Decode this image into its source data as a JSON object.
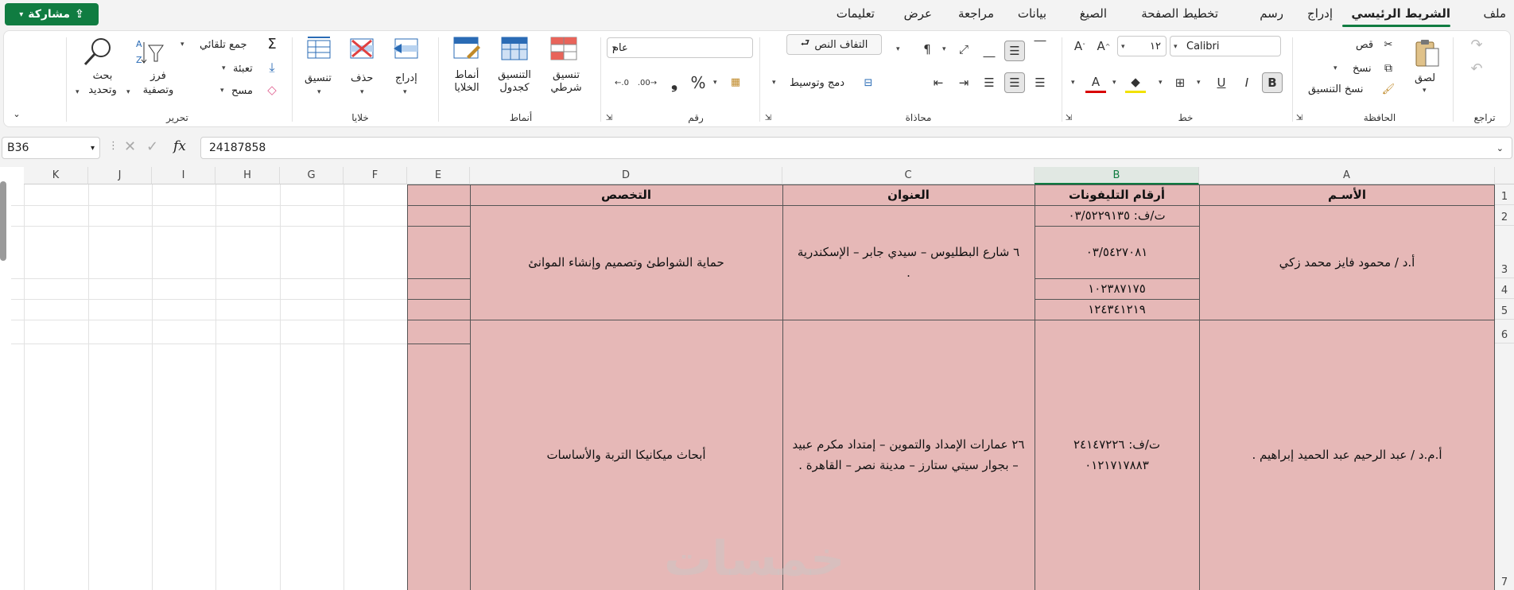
{
  "menu": {
    "items": [
      "ملف",
      "الشريط الرئيسي",
      "إدراج",
      "رسم",
      "تخطيط الصفحة",
      "الصيغ",
      "بيانات",
      "مراجعة",
      "عرض",
      "تعليمات"
    ],
    "active_index": 1,
    "share_label": "مشاركة"
  },
  "ribbon": {
    "undo": {
      "label": "تراجع"
    },
    "clipboard": {
      "label": "الحافظة",
      "paste": "لصق",
      "cut": "قص",
      "copy": "نسخ",
      "format_painter": "نسخ التنسيق"
    },
    "font": {
      "label": "خط",
      "name": "Calibri",
      "size": "١٢"
    },
    "alignment": {
      "label": "محاذاة",
      "wrap_text": "التفاف النص",
      "merge_center": "دمج وتوسيط"
    },
    "number": {
      "label": "رقم",
      "format": "عام"
    },
    "styles": {
      "label": "أنماط",
      "conditional": "تنسيق شرطي",
      "format_table": "التنسيق كجدول",
      "cell_styles": "أنماط الخلايا"
    },
    "cells": {
      "label": "خلايا",
      "insert": "إدراج",
      "delete": "حذف",
      "format": "تنسيق"
    },
    "editing": {
      "label": "تحرير",
      "autosum": "جمع تلقائي",
      "fill": "تعبئة",
      "clear": "مسح",
      "sort_filter": "فرز وتصفية",
      "find_select": "بحث وتحديد"
    }
  },
  "formula_bar": {
    "name_box": "B36",
    "value": "24187858"
  },
  "sheet": {
    "columns": [
      "A",
      "B",
      "C",
      "D",
      "E",
      "F",
      "G",
      "H",
      "I",
      "J",
      "K"
    ],
    "selected_column": "B",
    "rows": [
      "1",
      "2",
      "3",
      "4",
      "5",
      "6",
      "7"
    ],
    "headers": {
      "A": "الأسـم",
      "B": "أرقام التليفونات",
      "C": "العنوان",
      "D": "التخصص"
    },
    "record1": {
      "name": "أ.د / محمود فايز محمد زكي",
      "phone1": "ت/ف: ٠٣/٥٢٢٩١٣٥",
      "phone2": "٠٣/٥٤٢٧٠٨١",
      "phone3": "١٠٢٣٨٧١٧٥",
      "phone4": "١٢٤٣٤١٢١٩",
      "address": "٦ شارع البطليوس – سيدي جابر – الإسكندرية .",
      "specialty": "حماية الشواطئ وتصميم وإنشاء الموانئ"
    },
    "record2": {
      "name": "أ.م.د / عبد الرحيم عبد الحميد إبراهيم .",
      "phone1": "ت/ف: ٢٤١٤٧٢٢٦",
      "phone2": "٠١٢١٧١٧٨٨٣",
      "address": "٢٦ عمارات الإمداد والتموين – إمتداد مكرم عبيد – بجوار سيتي ستارز – مدينة نصر – القاهرة .",
      "specialty": "أبحاث ميكانيكا التربة والأساسات"
    }
  },
  "watermark": "خمسات",
  "colors": {
    "accent": "#107c41",
    "cell_fill": "#e6b8b7"
  }
}
